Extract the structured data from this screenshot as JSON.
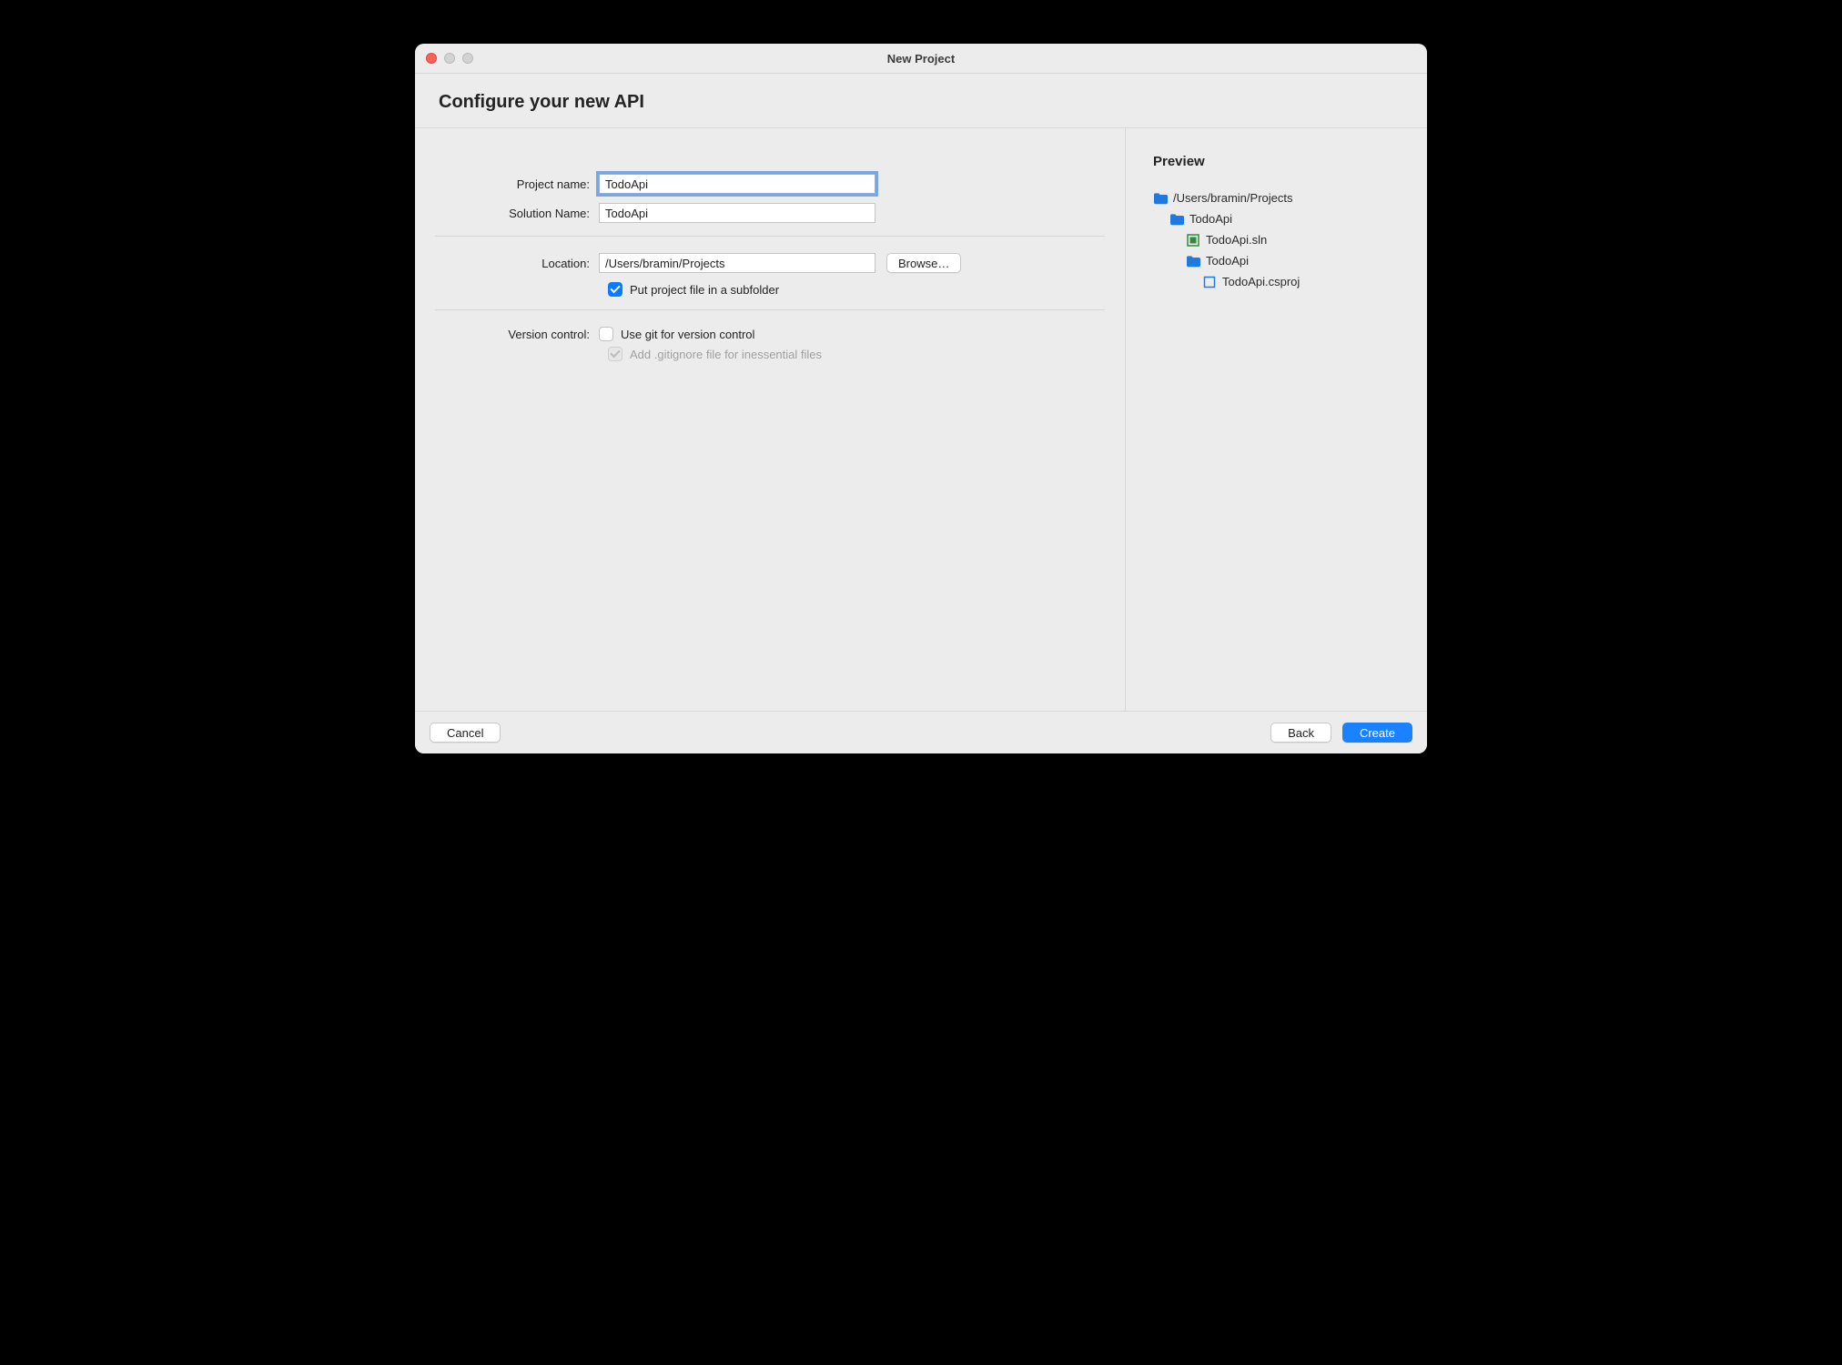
{
  "window": {
    "title": "New Project"
  },
  "header": {
    "title": "Configure your new API"
  },
  "form": {
    "projectName": {
      "label": "Project name:",
      "value": "TodoApi"
    },
    "solutionName": {
      "label": "Solution Name:",
      "value": "TodoApi"
    },
    "location": {
      "label": "Location:",
      "value": "/Users/bramin/Projects",
      "browse": "Browse…"
    },
    "subfolder": {
      "checked": true,
      "label": "Put project file in a subfolder"
    },
    "versionControl": {
      "label": "Version control:",
      "useGit": {
        "checked": false,
        "label": "Use git for version control"
      },
      "gitignore": {
        "checked": true,
        "disabled": true,
        "label": "Add .gitignore file for inessential files"
      }
    }
  },
  "preview": {
    "title": "Preview",
    "tree": {
      "root": "/Users/bramin/Projects",
      "solutionFolder": "TodoApi",
      "solutionFile": "TodoApi.sln",
      "projectFolder": "TodoApi",
      "projectFile": "TodoApi.csproj"
    }
  },
  "footer": {
    "cancel": "Cancel",
    "back": "Back",
    "create": "Create"
  }
}
